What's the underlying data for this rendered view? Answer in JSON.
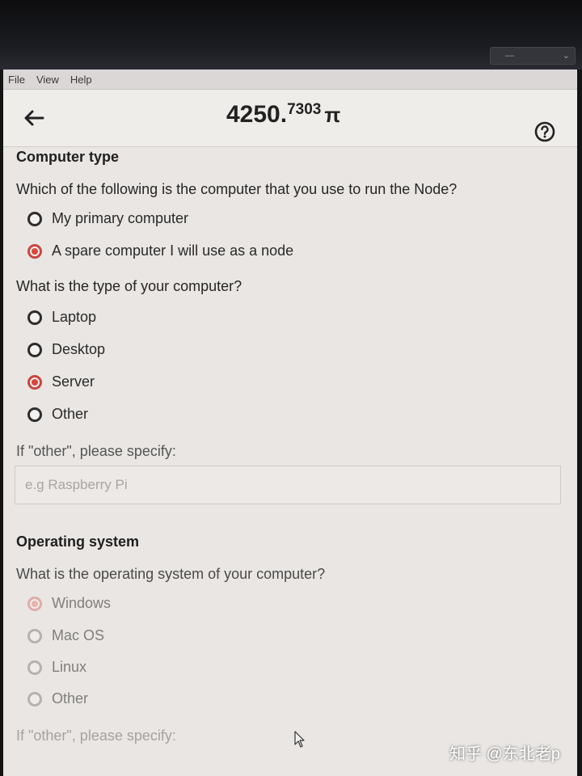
{
  "menu": {
    "file": "File",
    "view": "View",
    "help": "Help"
  },
  "window_control": {
    "dash": "—",
    "chevron": "⌄"
  },
  "header": {
    "balance_int": "4250.",
    "balance_dec": "7303",
    "unit": "π"
  },
  "computer_type": {
    "title": "Computer type",
    "q1": "Which of the following is the computer that you use to run the Node?",
    "q1_options": [
      {
        "label": "My primary computer",
        "checked": false
      },
      {
        "label": "A spare computer I will use as a node",
        "checked": true
      }
    ],
    "q2": "What is the type of your computer?",
    "q2_options": [
      {
        "label": "Laptop",
        "checked": false
      },
      {
        "label": "Desktop",
        "checked": false
      },
      {
        "label": "Server",
        "checked": true
      },
      {
        "label": "Other",
        "checked": false
      }
    ],
    "other_label": "If \"other\", please specify:",
    "other_placeholder": "e.g Raspberry Pi"
  },
  "operating_system": {
    "title": "Operating system",
    "q": "What is the operating system of your computer?",
    "options": [
      {
        "label": "Windows",
        "checked": true
      },
      {
        "label": "Mac OS",
        "checked": false
      },
      {
        "label": "Linux",
        "checked": false
      },
      {
        "label": "Other",
        "checked": false
      }
    ],
    "other_label": "If \"other\", please specify:"
  },
  "watermark": "知乎 @东北老p",
  "icons": {
    "back": "arrow-left-icon",
    "help": "question-circle-icon",
    "cursor": "mouse-pointer-icon"
  },
  "colors": {
    "accent": "#d9473f",
    "background": "#e9e6e3",
    "header": "#efedea"
  }
}
